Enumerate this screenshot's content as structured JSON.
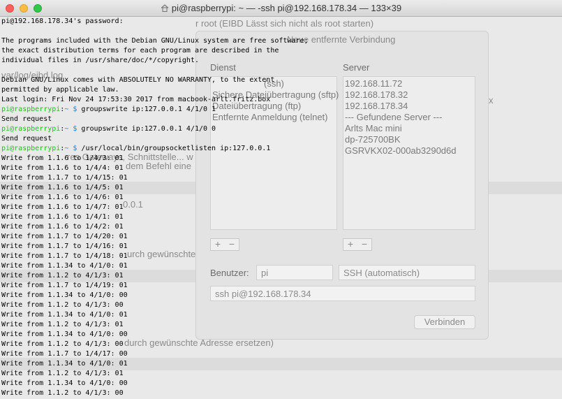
{
  "window": {
    "title": "pi@raspberrypi: ~ — -ssh pi@192.168.178.34 — 133×39",
    "colors": {
      "prompt_green": "#2eb62e",
      "tilde_blue": "#1f7fd6",
      "background": "#ffffff",
      "text": "#000000"
    }
  },
  "background_overlay": {
    "fragments": [
      "r root (EIBD Lässt sich nicht als root starten)",
      "var/log/eibd.log",
      "res Gateways, Schnittstelle... w",
      "dem Befehl eine",
      "0.0.1",
      "urch gewünschte",
      "durch gewünschte Adresse ersetzen)"
    ],
    "dialog": {
      "title": "Neue entfernte Verbindung",
      "col_service": "Dienst",
      "col_server": "Server",
      "services": [
        "(ssh)",
        "Sichere Dateiübertragung (sftp)",
        "Dateiübertragung (ftp)",
        "Entfernte Anmeldung (telnet)"
      ],
      "servers": [
        "192.168.11.72",
        "192.168.178.32",
        "192.168.178.34",
        "--- Gefundene Server ---",
        "Arlts Mac mini",
        "dp-725700BK",
        "GSRVKX02-000ab3290d6d"
      ],
      "plus": "+",
      "minus": "−",
      "user_label": "Benutzer:",
      "user_value": "pi",
      "protocol": "SSH (automatisch)",
      "command": "ssh pi@192.168.178.34",
      "connect": "Verbinden",
      "trailing_x": "x"
    }
  },
  "terminal": {
    "prompt": {
      "user_host": "pi@raspberrypi",
      "colon": ":",
      "tilde": "~",
      "dollar": " $ "
    },
    "lines": [
      {
        "t": "text",
        "v": "pi@192.168.178.34's password: "
      },
      {
        "t": "text",
        "v": ""
      },
      {
        "t": "text",
        "v": "The programs included with the Debian GNU/Linux system are free software;"
      },
      {
        "t": "text",
        "v": "the exact distribution terms for each program are described in the"
      },
      {
        "t": "text",
        "v": "individual files in /usr/share/doc/*/copyright."
      },
      {
        "t": "text",
        "v": ""
      },
      {
        "t": "text",
        "v": "Debian GNU/Linux comes with ABSOLUTELY NO WARRANTY, to the extent"
      },
      {
        "t": "text",
        "v": "permitted by applicable law."
      },
      {
        "t": "text",
        "v": "Last login: Fri Nov 24 17:53:30 2017 from macbook-arlt.fritz.box"
      },
      {
        "t": "cmd",
        "v": "groupswrite ip:127.0.0.1 4/1/0 1"
      },
      {
        "t": "text",
        "v": "Send request"
      },
      {
        "t": "cmd",
        "v": "groupswrite ip:127.0.0.1 4/1/0 0"
      },
      {
        "t": "text",
        "v": "Send request"
      },
      {
        "t": "cmd",
        "v": "/usr/local/bin/groupsocketlisten ip:127.0.0.1"
      },
      {
        "t": "text",
        "v": "Write from 1.1.6 to 1/4/3: 01"
      },
      {
        "t": "text",
        "v": "Write from 1.1.6 to 1/4/4: 01"
      },
      {
        "t": "text",
        "v": "Write from 1.1.7 to 1/4/15: 01"
      },
      {
        "t": "text",
        "v": "Write from 1.1.6 to 1/4/5: 01"
      },
      {
        "t": "text",
        "v": "Write from 1.1.6 to 1/4/6: 01"
      },
      {
        "t": "text",
        "v": "Write from 1.1.6 to 1/4/7: 01"
      },
      {
        "t": "text",
        "v": "Write from 1.1.6 to 1/4/1: 01"
      },
      {
        "t": "text",
        "v": "Write from 1.1.6 to 1/4/2: 01"
      },
      {
        "t": "text",
        "v": "Write from 1.1.7 to 1/4/20: 01"
      },
      {
        "t": "text",
        "v": "Write from 1.1.7 to 1/4/16: 01"
      },
      {
        "t": "text",
        "v": "Write from 1.1.7 to 1/4/18: 01"
      },
      {
        "t": "text",
        "v": "Write from 1.1.34 to 4/1/0: 01"
      },
      {
        "t": "text",
        "v": "Write from 1.1.2 to 4/1/3: 01"
      },
      {
        "t": "text",
        "v": "Write from 1.1.7 to 1/4/19: 01"
      },
      {
        "t": "text",
        "v": "Write from 1.1.34 to 4/1/0: 00"
      },
      {
        "t": "text",
        "v": "Write from 1.1.2 to 4/1/3: 00"
      },
      {
        "t": "text",
        "v": "Write from 1.1.34 to 4/1/0: 01"
      },
      {
        "t": "text",
        "v": "Write from 1.1.2 to 4/1/3: 01"
      },
      {
        "t": "text",
        "v": "Write from 1.1.34 to 4/1/0: 00"
      },
      {
        "t": "text",
        "v": "Write from 1.1.2 to 4/1/3: 00"
      },
      {
        "t": "text",
        "v": "Write from 1.1.7 to 1/4/17: 00"
      },
      {
        "t": "text",
        "v": "Write from 1.1.34 to 4/1/0: 01"
      },
      {
        "t": "text",
        "v": "Write from 1.1.2 to 4/1/3: 01"
      },
      {
        "t": "text",
        "v": "Write from 1.1.34 to 4/1/0: 00"
      },
      {
        "t": "text",
        "v": "Write from 1.1.2 to 4/1/3: 00"
      }
    ]
  }
}
